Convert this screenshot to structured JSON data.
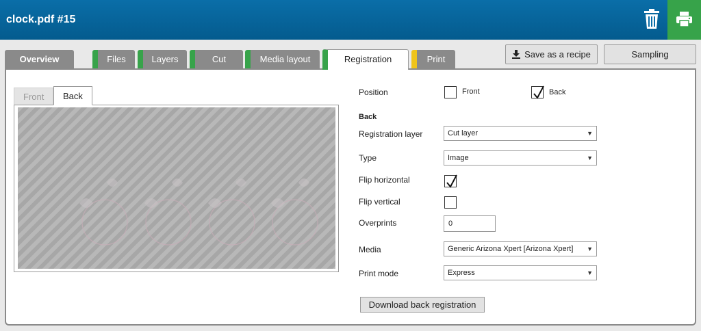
{
  "header": {
    "title": "clock.pdf #15",
    "accent": "#045b8e",
    "print_color": "#37a34a",
    "icons": [
      "trash-icon",
      "printer-icon"
    ]
  },
  "tabs": [
    {
      "label": "Overview",
      "status": "none"
    },
    {
      "label": "Files",
      "status": "green"
    },
    {
      "label": "Layers",
      "status": "green"
    },
    {
      "label": "Cut",
      "status": "green"
    },
    {
      "label": "Media layout",
      "status": "green"
    },
    {
      "label": "Registration",
      "status": "green",
      "active": true
    },
    {
      "label": "Print",
      "status": "yellow"
    }
  ],
  "toolbar": {
    "save_recipe_label": "Save as a recipe",
    "sampling_label": "Sampling"
  },
  "preview": {
    "front_tab": "Front",
    "back_tab": "Back",
    "active": "Back"
  },
  "form": {
    "position_label": "Position",
    "front_option": "Front",
    "front_checked": false,
    "back_option": "Back",
    "back_checked": true,
    "section_title": "Back",
    "registration_layer_label": "Registration layer",
    "registration_layer_value": "Cut layer",
    "type_label": "Type",
    "type_value": "Image",
    "flip_horizontal_label": "Flip horizontal",
    "flip_horizontal_checked": true,
    "flip_vertical_label": "Flip vertical",
    "flip_vertical_checked": false,
    "overprints_label": "Overprints",
    "overprints_value": "0",
    "media_label": "Media",
    "media_value": "Generic Arizona Xpert [Arizona Xpert]",
    "print_mode_label": "Print mode",
    "print_mode_value": "Express",
    "download_label": "Download back registration"
  }
}
